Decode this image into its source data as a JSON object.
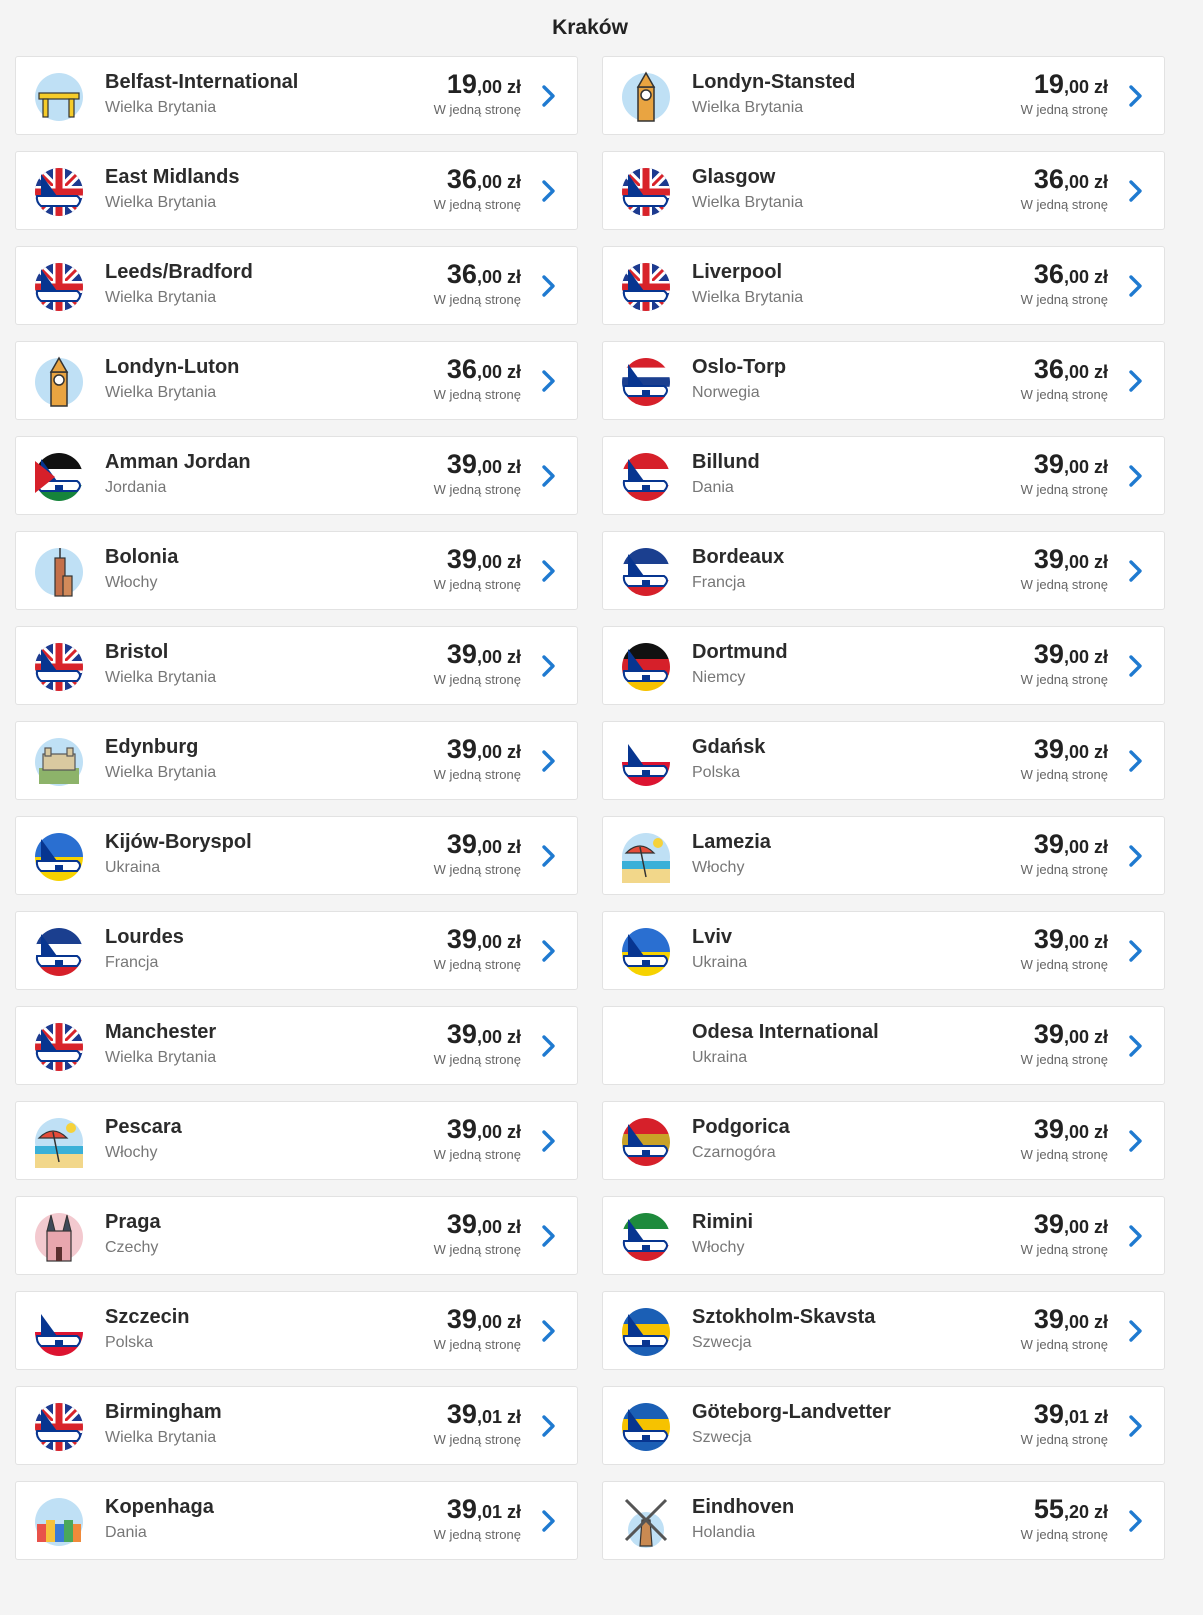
{
  "page": {
    "title": "Kraków"
  },
  "labels": {
    "one_way": "W jedną stronę",
    "currency": "zł"
  },
  "destinations": [
    {
      "city": "Belfast-International",
      "country": "Wielka Brytania",
      "price_whole": "19",
      "price_cents": ",00",
      "icon": "landmark-cranes"
    },
    {
      "city": "Londyn-Stansted",
      "country": "Wielka Brytania",
      "price_whole": "19",
      "price_cents": ",00",
      "icon": "big-ben"
    },
    {
      "city": "East Midlands",
      "country": "Wielka Brytania",
      "price_whole": "36",
      "price_cents": ",00",
      "icon": "plane-uk"
    },
    {
      "city": "Glasgow",
      "country": "Wielka Brytania",
      "price_whole": "36",
      "price_cents": ",00",
      "icon": "plane-uk"
    },
    {
      "city": "Leeds/Bradford",
      "country": "Wielka Brytania",
      "price_whole": "36",
      "price_cents": ",00",
      "icon": "plane-uk"
    },
    {
      "city": "Liverpool",
      "country": "Wielka Brytania",
      "price_whole": "36",
      "price_cents": ",00",
      "icon": "plane-uk"
    },
    {
      "city": "Londyn-Luton",
      "country": "Wielka Brytania",
      "price_whole": "36",
      "price_cents": ",00",
      "icon": "big-ben"
    },
    {
      "city": "Oslo-Torp",
      "country": "Norwegia",
      "price_whole": "36",
      "price_cents": ",00",
      "icon": "plane-norway"
    },
    {
      "city": "Amman Jordan",
      "country": "Jordania",
      "price_whole": "39",
      "price_cents": ",00",
      "icon": "plane-jordan"
    },
    {
      "city": "Billund",
      "country": "Dania",
      "price_whole": "39",
      "price_cents": ",00",
      "icon": "plane-denmark"
    },
    {
      "city": "Bolonia",
      "country": "Włochy",
      "price_whole": "39",
      "price_cents": ",00",
      "icon": "tower"
    },
    {
      "city": "Bordeaux",
      "country": "Francja",
      "price_whole": "39",
      "price_cents": ",00",
      "icon": "plane-france"
    },
    {
      "city": "Bristol",
      "country": "Wielka Brytania",
      "price_whole": "39",
      "price_cents": ",00",
      "icon": "plane-uk"
    },
    {
      "city": "Dortmund",
      "country": "Niemcy",
      "price_whole": "39",
      "price_cents": ",00",
      "icon": "plane-germany"
    },
    {
      "city": "Edynburg",
      "country": "Wielka Brytania",
      "price_whole": "39",
      "price_cents": ",00",
      "icon": "castle"
    },
    {
      "city": "Gdańsk",
      "country": "Polska",
      "price_whole": "39",
      "price_cents": ",00",
      "icon": "plane-poland"
    },
    {
      "city": "Kijów-Boryspol",
      "country": "Ukraina",
      "price_whole": "39",
      "price_cents": ",00",
      "icon": "plane-ukraine"
    },
    {
      "city": "Lamezia",
      "country": "Włochy",
      "price_whole": "39",
      "price_cents": ",00",
      "icon": "beach"
    },
    {
      "city": "Lourdes",
      "country": "Francja",
      "price_whole": "39",
      "price_cents": ",00",
      "icon": "plane-france"
    },
    {
      "city": "Lviv",
      "country": "Ukraina",
      "price_whole": "39",
      "price_cents": ",00",
      "icon": "plane-ukraine"
    },
    {
      "city": "Manchester",
      "country": "Wielka Brytania",
      "price_whole": "39",
      "price_cents": ",00",
      "icon": "plane-uk"
    },
    {
      "city": "Odesa International",
      "country": "Ukraina",
      "price_whole": "39",
      "price_cents": ",00",
      "icon": "none"
    },
    {
      "city": "Pescara",
      "country": "Włochy",
      "price_whole": "39",
      "price_cents": ",00",
      "icon": "beach"
    },
    {
      "city": "Podgorica",
      "country": "Czarnogóra",
      "price_whole": "39",
      "price_cents": ",00",
      "icon": "plane-montenegro"
    },
    {
      "city": "Praga",
      "country": "Czechy",
      "price_whole": "39",
      "price_cents": ",00",
      "icon": "church"
    },
    {
      "city": "Rimini",
      "country": "Włochy",
      "price_whole": "39",
      "price_cents": ",00",
      "icon": "plane-italy"
    },
    {
      "city": "Szczecin",
      "country": "Polska",
      "price_whole": "39",
      "price_cents": ",00",
      "icon": "plane-poland"
    },
    {
      "city": "Sztokholm-Skavsta",
      "country": "Szwecja",
      "price_whole": "39",
      "price_cents": ",00",
      "icon": "plane-sweden"
    },
    {
      "city": "Birmingham",
      "country": "Wielka Brytania",
      "price_whole": "39",
      "price_cents": ",01",
      "icon": "plane-uk"
    },
    {
      "city": "Göteborg-Landvetter",
      "country": "Szwecja",
      "price_whole": "39",
      "price_cents": ",01",
      "icon": "plane-sweden"
    },
    {
      "city": "Kopenhaga",
      "country": "Dania",
      "price_whole": "39",
      "price_cents": ",01",
      "icon": "houses"
    },
    {
      "city": "Eindhoven",
      "country": "Holandia",
      "price_whole": "55",
      "price_cents": ",20",
      "icon": "windmill"
    }
  ]
}
